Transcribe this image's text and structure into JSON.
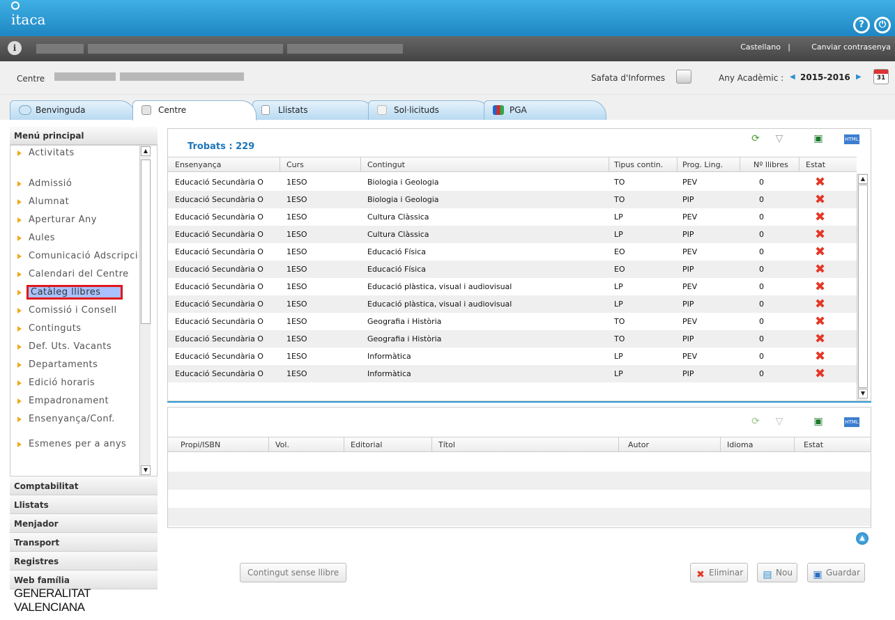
{
  "app": {
    "logo_text": "itaca"
  },
  "top_icons": [
    "help-icon",
    "logout-icon"
  ],
  "userbar": {
    "language_link": "Castellano",
    "separator": "|",
    "change_password_link": "Canviar contrasenya"
  },
  "infoline": {
    "centre_label": "Centre",
    "report_tray_label": "Safata d'Informes",
    "academic_year_label": "Any Acadèmic :",
    "academic_year_value": "2015-2016",
    "calendar_day": "31"
  },
  "tabs": [
    {
      "label": "Benvinguda"
    },
    {
      "label": "Centre"
    },
    {
      "label": "Llistats"
    },
    {
      "label": "Sol·licituds"
    },
    {
      "label": "PGA"
    }
  ],
  "sidebar": {
    "main_menu_title": "Menú principal",
    "items": [
      "Activitats",
      "Admissió",
      "Alumnat",
      "Aperturar Any",
      "Aules",
      "Comunicació Adscripció",
      "Calendari del Centre",
      "Catàleg llibres",
      "Comissió i Consell",
      "Continguts",
      "Def. Uts. Vacants",
      "Departaments",
      "Edició horaris",
      "Empadronament",
      "Ensenyança/Conf.",
      "Esmenes per a anys"
    ],
    "selected_item": "Catàleg llibres",
    "sections": [
      "Comptabilitat",
      "Llistats",
      "Menjador",
      "Transport",
      "Registres",
      "Web família"
    ],
    "footer_logo": "GENERALITAT VALENCIANA"
  },
  "grid1": {
    "found_label": "Trobats : 229",
    "toolbar": [
      "refresh-icon",
      "filter-icon",
      "excel-export-icon",
      "html-export-icon"
    ],
    "columns": [
      "Ensenyança",
      "Curs",
      "Contingut",
      "Tipus contin.",
      "Prog. Ling.",
      "Nº llibres",
      "Estat"
    ],
    "rows": [
      [
        "Educació Secundària O",
        "1ESO",
        "Biologia i Geologia",
        "TO",
        "PEV",
        "0"
      ],
      [
        "Educació Secundària O",
        "1ESO",
        "Biologia i Geologia",
        "TO",
        "PIP",
        "0"
      ],
      [
        "Educació Secundària O",
        "1ESO",
        "Cultura Clàssica",
        "LP",
        "PEV",
        "0"
      ],
      [
        "Educació Secundària O",
        "1ESO",
        "Cultura Clàssica",
        "LP",
        "PIP",
        "0"
      ],
      [
        "Educació Secundària O",
        "1ESO",
        "Educació Física",
        "EO",
        "PEV",
        "0"
      ],
      [
        "Educació Secundària O",
        "1ESO",
        "Educació Física",
        "EO",
        "PIP",
        "0"
      ],
      [
        "Educació Secundària O",
        "1ESO",
        "Educació plàstica, visual i audiovisual",
        "LP",
        "PEV",
        "0"
      ],
      [
        "Educació Secundària O",
        "1ESO",
        "Educació plàstica, visual i audiovisual",
        "LP",
        "PIP",
        "0"
      ],
      [
        "Educació Secundària O",
        "1ESO",
        "Geografia i Història",
        "TO",
        "PEV",
        "0"
      ],
      [
        "Educació Secundària O",
        "1ESO",
        "Geografia i Història",
        "TO",
        "PIP",
        "0"
      ],
      [
        "Educació Secundària O",
        "1ESO",
        "Informàtica",
        "LP",
        "PEV",
        "0"
      ],
      [
        "Educació Secundària O",
        "1ESO",
        "Informàtica",
        "LP",
        "PIP",
        "0"
      ]
    ]
  },
  "grid2": {
    "toolbar": [
      "refresh-icon",
      "filter-icon",
      "excel-export-icon",
      "html-export-icon"
    ],
    "columns": [
      "Propi/ISBN",
      "Vol.",
      "Editorial",
      "Títol",
      "Autor",
      "Idioma",
      "Estat"
    ]
  },
  "buttons": {
    "no_book_content": "Contingut sense llibre",
    "delete": "Eliminar",
    "new": "Nou",
    "save": "Guardar"
  },
  "colors": {
    "accent": "#1e86c3",
    "delete_red": "#e53626",
    "selected_highlight": "#a9c2ff",
    "selected_outline": "#e0181b"
  }
}
